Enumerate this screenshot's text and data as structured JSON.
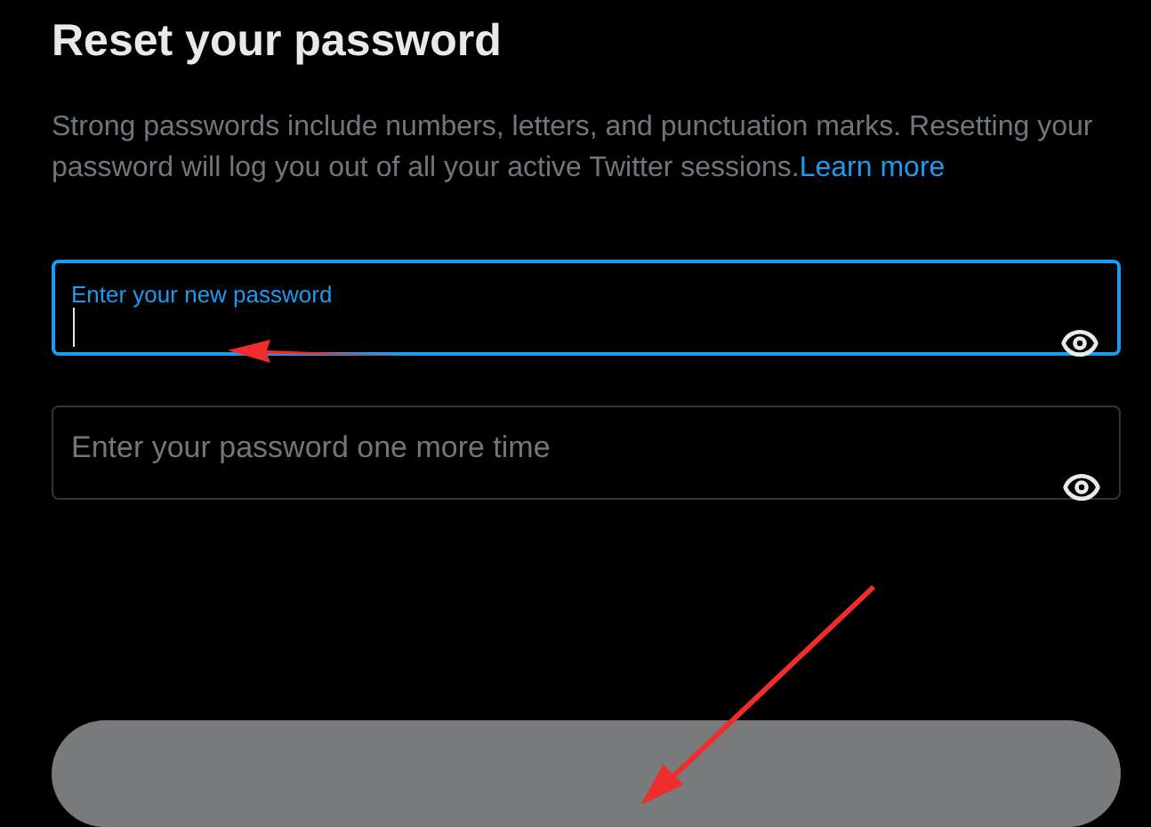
{
  "title": "Reset your password",
  "description": {
    "text": "Strong passwords include numbers, letters, and punctuation marks. Resetting your password will log you out of all your active Twitter sessions.",
    "link": "Learn more"
  },
  "fields": [
    {
      "label": "Enter your new password",
      "focused": true
    },
    {
      "placeholder": "Enter your password one more time",
      "focused": false
    }
  ]
}
